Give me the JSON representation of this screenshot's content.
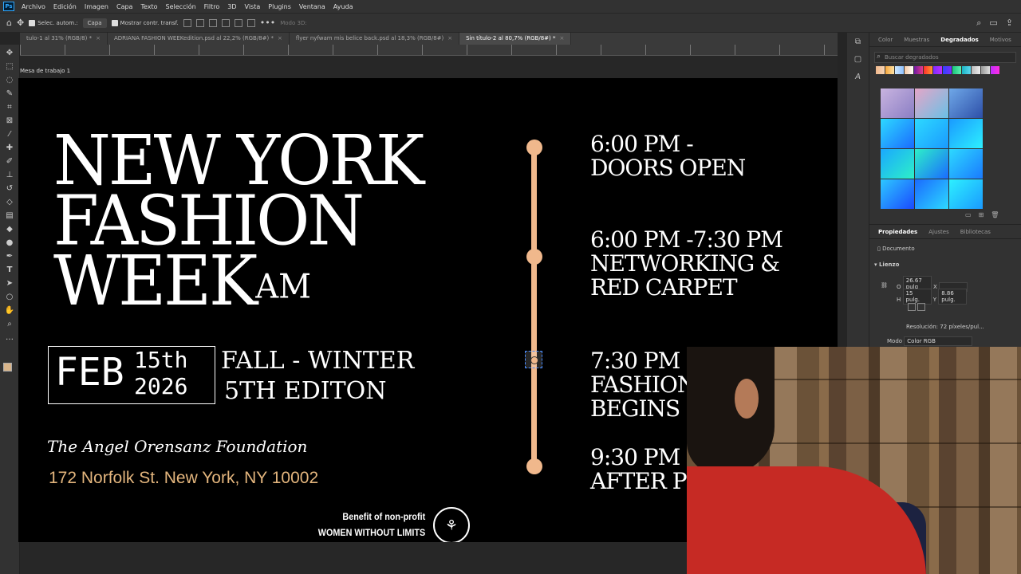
{
  "app": {
    "logo": "Ps"
  },
  "menu": [
    "Archivo",
    "Edición",
    "Imagen",
    "Capa",
    "Texto",
    "Selección",
    "Filtro",
    "3D",
    "Vista",
    "Plugins",
    "Ventana",
    "Ayuda"
  ],
  "options_bar": {
    "auto_select_label": "Selec. autom.:",
    "auto_select_value": "Capa",
    "show_transform_label": "Mostrar contr. transf.",
    "mode_3d_label": "Modo 3D:"
  },
  "tabs": [
    {
      "label": "tulo-1 al 31% (RGB/8) *",
      "active": false
    },
    {
      "label": "ADRIANA FASHION WEEKedition.psd al 22,2% (RGB/8#) *",
      "active": false
    },
    {
      "label": "flyer nyfwam  mis belice  back.psd al 18,3% (RGB/8#)",
      "active": false
    },
    {
      "label": "Sin título-2 al 80,7% (RGB/8#) *",
      "active": true
    }
  ],
  "artboard_label": "Mesa de trabajo 1",
  "flyer": {
    "title_line1": "NEW YORK",
    "title_line2": "FASHION",
    "title_line3": "WEEK",
    "title_sup": "AM",
    "date_month": "FEB",
    "date_day": "15th",
    "date_year": "2026",
    "season_line1": "FALL - WINTER",
    "season_line2": "5TH EDITON",
    "venue": "The Angel Orensanz Foundation",
    "address": "172 Norfolk St. New York, NY 10002",
    "benefit_line1": "Benefit of non-profit",
    "benefit_line2": "WOMEN WITHOUT LIMITS",
    "accent_color": "#f0b88c",
    "address_color": "#e3b57d"
  },
  "schedule": [
    {
      "line1": "6:00 PM -",
      "line2": "DOORS OPEN",
      "line3": ""
    },
    {
      "line1": "6:00 PM -7:30 PM",
      "line2": "NETWORKING &",
      "line3": "RED CARPET"
    },
    {
      "line1": "7:30 PM -",
      "line2": "FASHION",
      "line3": "BEGINS"
    },
    {
      "line1": "9:30 PM -",
      "line2": "AFTER P",
      "line3": ""
    }
  ],
  "gradients_panel": {
    "tabs": [
      "Color",
      "Muestras",
      "Degradados",
      "Motivos"
    ],
    "active_tab": "Degradados",
    "search_placeholder": "Buscar degradados"
  },
  "properties_panel": {
    "tabs": [
      "Propiedades",
      "Ajustes",
      "Bibliotecas"
    ],
    "doc_label": "Documento",
    "section": "Lienzo",
    "width_label": "O",
    "width_value": "26.67 pulg",
    "x_label": "X",
    "height_label": "H",
    "height_value": "15 pulg.",
    "y_label": "Y",
    "y_value": "8.86 pulg.",
    "resolution": "Resolución: 72 píxeles/pul...",
    "mode_label": "Modo",
    "mode_value": "Color RGB"
  }
}
